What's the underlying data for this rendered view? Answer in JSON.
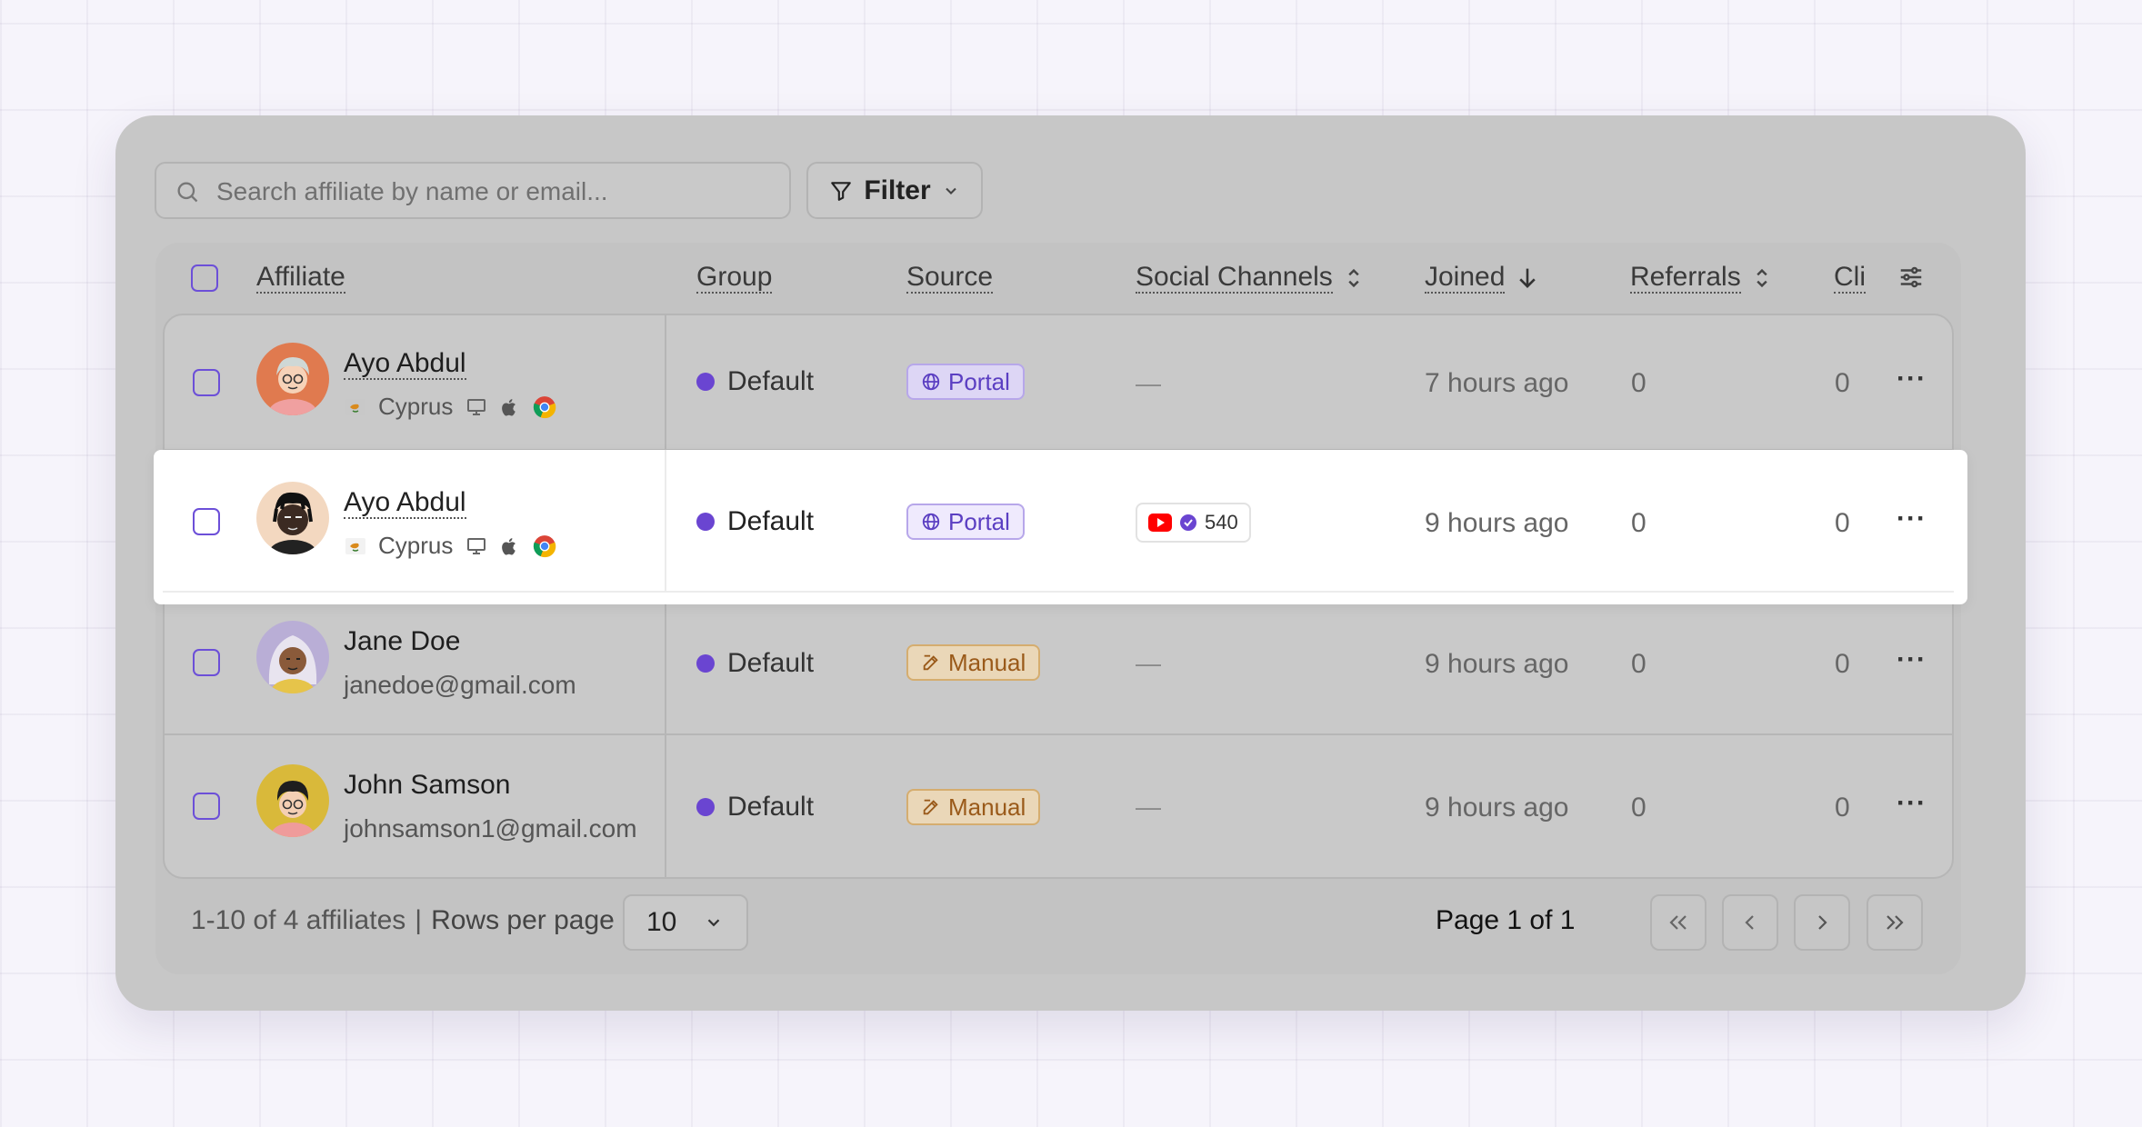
{
  "search": {
    "placeholder": "Search affiliate by name or email..."
  },
  "filter": {
    "label": "Filter"
  },
  "columns": {
    "affiliate": "Affiliate",
    "group": "Group",
    "source": "Source",
    "social": "Social Channels",
    "joined": "Joined",
    "referrals": "Referrals",
    "clicks": "Cli"
  },
  "rows": [
    {
      "name": "Ayo Abdul",
      "country": "Cyprus",
      "group": "Default",
      "source": "Portal",
      "social": "—",
      "joined": "7 hours ago",
      "referrals": "0",
      "clicks": "0",
      "more": "···"
    },
    {
      "name": "Ayo Abdul",
      "country": "Cyprus",
      "group": "Default",
      "source": "Portal",
      "social_count": "540",
      "joined": "9 hours ago",
      "referrals": "0",
      "clicks": "0",
      "more": "···"
    },
    {
      "name": "Jane Doe",
      "email": "janedoe@gmail.com",
      "group": "Default",
      "source": "Manual",
      "social": "—",
      "joined": "9 hours ago",
      "referrals": "0",
      "clicks": "0",
      "more": "···"
    },
    {
      "name": "John Samson",
      "email": "johnsamson1@gmail.com",
      "group": "Default",
      "source": "Manual",
      "social": "—",
      "joined": "9 hours ago",
      "referrals": "0",
      "clicks": "0",
      "more": "···"
    }
  ],
  "footer": {
    "range": "1-10 of 4 affiliates",
    "separator": "|",
    "rows_per_page_label": "Rows per page",
    "rows_per_page_value": "10",
    "page_info": "Page 1 of 1"
  },
  "colors": {
    "accent": "#6a45d1",
    "portal": "#5b3fc2",
    "manual": "#9a5a1a",
    "youtube": "#ff0000"
  },
  "icons": [
    "search-icon",
    "filter-icon",
    "chevron-down-icon",
    "sort-icon",
    "arrow-down-icon",
    "settings-sliders-icon",
    "cyprus-flag-icon",
    "desktop-icon",
    "apple-icon",
    "chrome-icon",
    "globe-icon",
    "edit-icon",
    "youtube-icon",
    "verified-icon",
    "more-icon",
    "first-page-icon",
    "prev-page-icon",
    "next-page-icon",
    "last-page-icon"
  ]
}
